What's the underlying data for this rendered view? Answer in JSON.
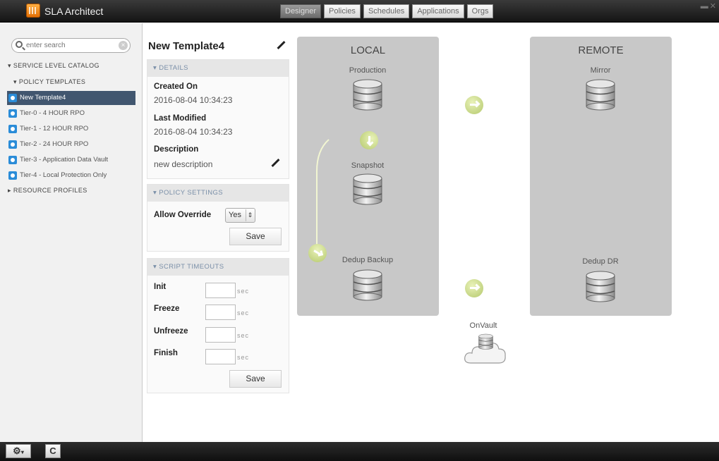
{
  "app": {
    "title": "SLA Architect"
  },
  "tabs": [
    {
      "label": "Designer",
      "active": true
    },
    {
      "label": "Policies",
      "active": false
    },
    {
      "label": "Schedules",
      "active": false
    },
    {
      "label": "Applications",
      "active": false
    },
    {
      "label": "Orgs",
      "active": false
    }
  ],
  "sidebar": {
    "search_placeholder": "enter search",
    "catalog_label": "SERVICE LEVEL CATALOG",
    "policy_templates_label": "POLICY TEMPLATES",
    "items": [
      {
        "label": "New Template4",
        "selected": true
      },
      {
        "label": "Tier-0 - 4 HOUR RPO"
      },
      {
        "label": "Tier-1 - 12 HOUR RPO"
      },
      {
        "label": "Tier-2 - 24 HOUR RPO"
      },
      {
        "label": "Tier-3 - Application Data Vault"
      },
      {
        "label": "Tier-4 - Local Protection Only"
      }
    ],
    "resource_profiles_label": "RESOURCE PROFILES"
  },
  "detail": {
    "template_name": "New Template4",
    "details_header": "DETAILS",
    "created_on_label": "Created On",
    "created_on_value": "2016-08-04 10:34:23",
    "last_modified_label": "Last Modified",
    "last_modified_value": "2016-08-04 10:34:23",
    "description_label": "Description",
    "description_value": "new description",
    "policy_settings_header": "POLICY SETTINGS",
    "allow_override_label": "Allow Override",
    "allow_override_value": "Yes",
    "save_label": "Save",
    "script_timeouts_header": "SCRIPT TIMEOUTS",
    "timeouts": [
      {
        "label": "Init",
        "unit": "sec"
      },
      {
        "label": "Freeze",
        "unit": "sec"
      },
      {
        "label": "Unfreeze",
        "unit": "sec"
      },
      {
        "label": "Finish",
        "unit": "sec"
      }
    ]
  },
  "canvas": {
    "local_title": "LOCAL",
    "remote_title": "REMOTE",
    "production_label": "Production",
    "snapshot_label": "Snapshot",
    "dedup_backup_label": "Dedup Backup",
    "mirror_label": "Mirror",
    "dedup_dr_label": "Dedup DR",
    "onvault_label": "OnVault"
  },
  "bottombar": {
    "refresh_label": "C"
  },
  "colors": {
    "selected": "#41566f",
    "accent_arrow": "#b4c86c",
    "zone": "#c8c8c8"
  },
  "icons": [
    "search-icon",
    "clear-icon",
    "edit-icon",
    "database-icon",
    "arrow-icon",
    "cloud-icon",
    "gear-icon"
  ]
}
